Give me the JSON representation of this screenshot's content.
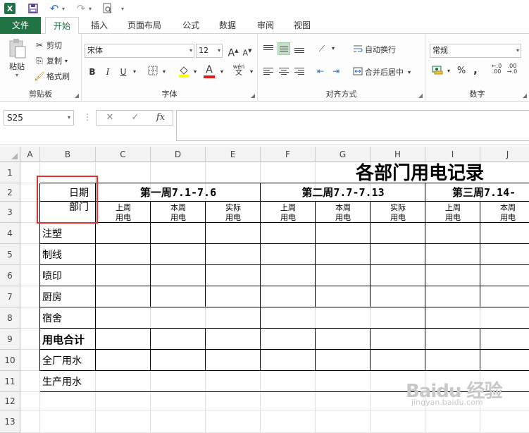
{
  "qat": {
    "excel_logo": "X",
    "dropdown_glyph": "▾"
  },
  "tabs": [
    {
      "label": "文件"
    },
    {
      "label": "开始"
    },
    {
      "label": "插入"
    },
    {
      "label": "页面布局"
    },
    {
      "label": "公式"
    },
    {
      "label": "数据"
    },
    {
      "label": "审阅"
    },
    {
      "label": "视图"
    }
  ],
  "ribbon": {
    "clipboard": {
      "paste": "粘贴",
      "cut": "剪切",
      "copy": "复制",
      "format_painter": "格式刷",
      "label": "剪贴板"
    },
    "font": {
      "name": "宋体",
      "size": "12",
      "bold": "B",
      "italic": "I",
      "underline": "U",
      "grow": "A",
      "shrink": "A",
      "pinyin": "wén",
      "label": "字体"
    },
    "alignment": {
      "wrap": "自动换行",
      "merge": "合并后居中",
      "label": "对齐方式"
    },
    "number": {
      "format": "常规",
      "percent": "%",
      "comma": ",",
      "label": "数字"
    }
  },
  "formula_bar": {
    "name_box": "S25",
    "fx": "fx",
    "cancel": "✕",
    "enter": "✓",
    "value": ""
  },
  "sheet": {
    "columns": [
      "A",
      "B",
      "C",
      "D",
      "E",
      "F",
      "G",
      "H",
      "I",
      "J"
    ],
    "rows": [
      "1",
      "2",
      "3",
      "4",
      "5",
      "6",
      "7",
      "8",
      "9",
      "10",
      "11",
      "12",
      "13"
    ],
    "title": "各部门用电记录",
    "header_date": "日期",
    "header_dept": "部门",
    "weeks": [
      "第一周7.1-7.6",
      "第二周7.7-7.13",
      "第三周7.14-"
    ],
    "sub_headers": [
      [
        "上周",
        "用电"
      ],
      [
        "本周",
        "用电"
      ],
      [
        "实际",
        "用电"
      ],
      [
        "上周",
        "用电"
      ],
      [
        "本周",
        "用电"
      ],
      [
        "实际",
        "用电"
      ],
      [
        "上周",
        "用电"
      ],
      [
        "本周",
        "用电"
      ]
    ],
    "departments": [
      "注塑",
      "制线",
      "喷印",
      "厨房",
      "宿舍"
    ],
    "total_label": "用电合计",
    "extra_rows": [
      "全厂用水",
      "生产用水"
    ]
  },
  "watermark": {
    "brand": "Baidu 经验",
    "url": "jingyan.baidu.com"
  },
  "colors": {
    "accent": "#217346",
    "highlight": "#e03030"
  }
}
